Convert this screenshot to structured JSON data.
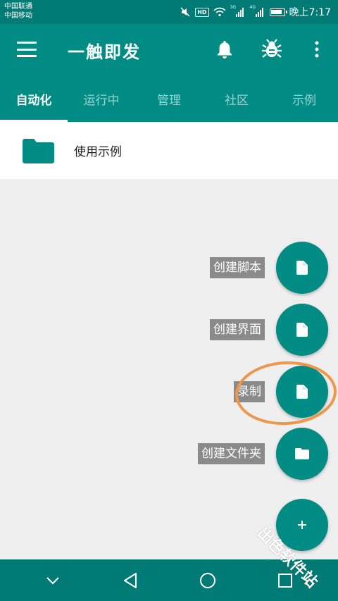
{
  "status_bar": {
    "carrier_1": "中国联通",
    "carrier_2": "中国移动",
    "hd_badge": "HD",
    "signal_1_label": "3G",
    "signal_2_label": "4G",
    "time": "晚上7:17"
  },
  "app_bar": {
    "title": "一触即发",
    "icons": [
      "menu-icon",
      "bell-icon",
      "bug-icon",
      "more-vert-icon"
    ]
  },
  "tabs": [
    {
      "label": "自动化",
      "active": true
    },
    {
      "label": "运行中",
      "active": false
    },
    {
      "label": "管理",
      "active": false
    },
    {
      "label": "社区",
      "active": false
    },
    {
      "label": "示例",
      "active": false
    }
  ],
  "list": {
    "items": [
      {
        "label": "使用示例",
        "icon": "folder-icon"
      }
    ]
  },
  "fab_menu": {
    "items": [
      {
        "label": "创建脚本",
        "icon": "file-icon"
      },
      {
        "label": "创建界面",
        "icon": "file-icon"
      },
      {
        "label": "录制",
        "icon": "file-icon"
      },
      {
        "label": "创建文件夹",
        "icon": "folder-icon"
      }
    ],
    "main_icon": "plus-icon"
  },
  "nav_bar": {
    "icons": [
      "chevron-down-icon",
      "back-triangle-icon",
      "home-circle-icon",
      "recents-square-icon"
    ]
  },
  "watermark": {
    "text": "出色软件站"
  },
  "colors": {
    "primary": "#008c85",
    "primary_dark": "#007a74",
    "label_bg": "#8a8a8a",
    "highlight": "#f0964a",
    "background": "#efefef"
  }
}
